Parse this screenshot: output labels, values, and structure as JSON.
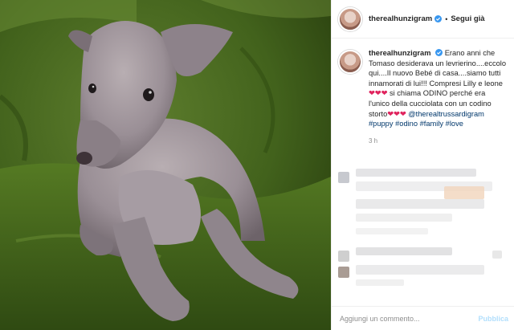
{
  "post": {
    "username": "therealhunzigram",
    "follow_label": "Segui già",
    "dot": "•",
    "caption_parts": [
      "Erano anni che Tomaso desiderava un levrierino....eccolo qui....Il nuovo Bebé di casa....siamo tutti innamorati di lui!!! Compresi Lilly e leone",
      "❤❤❤",
      " si chiama ODINO perché era l'unico della cucciolata con un codino storto",
      "❤❤❤"
    ],
    "tags": [
      "@therealtrussardigram",
      "#puppy",
      "#odino",
      "#family",
      "#love"
    ],
    "time": "3 h"
  },
  "footer": {
    "comment_placeholder": "Aggiungi un commento...",
    "publish_label": "Pubblica"
  },
  "icons": {
    "verified": "verified-badge-icon"
  },
  "colors": {
    "link": "#00376b",
    "verified": "#3897f0",
    "heart": "#e0245e",
    "publish": "#b2dffc"
  }
}
